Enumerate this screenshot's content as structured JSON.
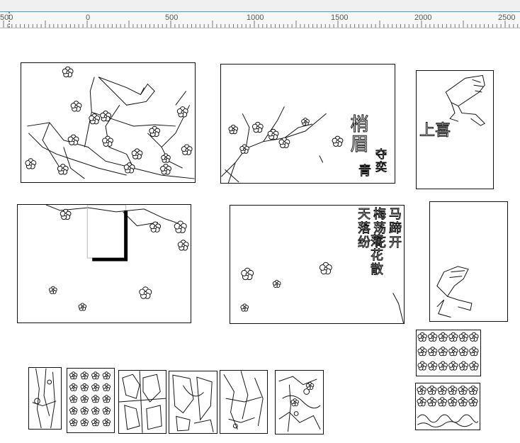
{
  "ruler": {
    "labels": [
      "500",
      "0",
      "500",
      "1000",
      "1500",
      "2000",
      "2500"
    ]
  },
  "artwork": {
    "panel_top_mid": {
      "title_right": "梢眉",
      "text_lower_a": "夺奕",
      "text_lower_b": "青"
    },
    "panel_tall_right": {
      "text": "上喜"
    },
    "panel_mid_center": {
      "columns": [
        "马蹄开",
        "梅荡花",
        "天落纷"
      ],
      "column_extra": "落花散"
    }
  },
  "colors": {
    "accent_line": "#3aa4e0",
    "stroke": "#111111",
    "ruler_bg": "#f7f7f7",
    "topbar_bg": "#f0f0f0"
  }
}
